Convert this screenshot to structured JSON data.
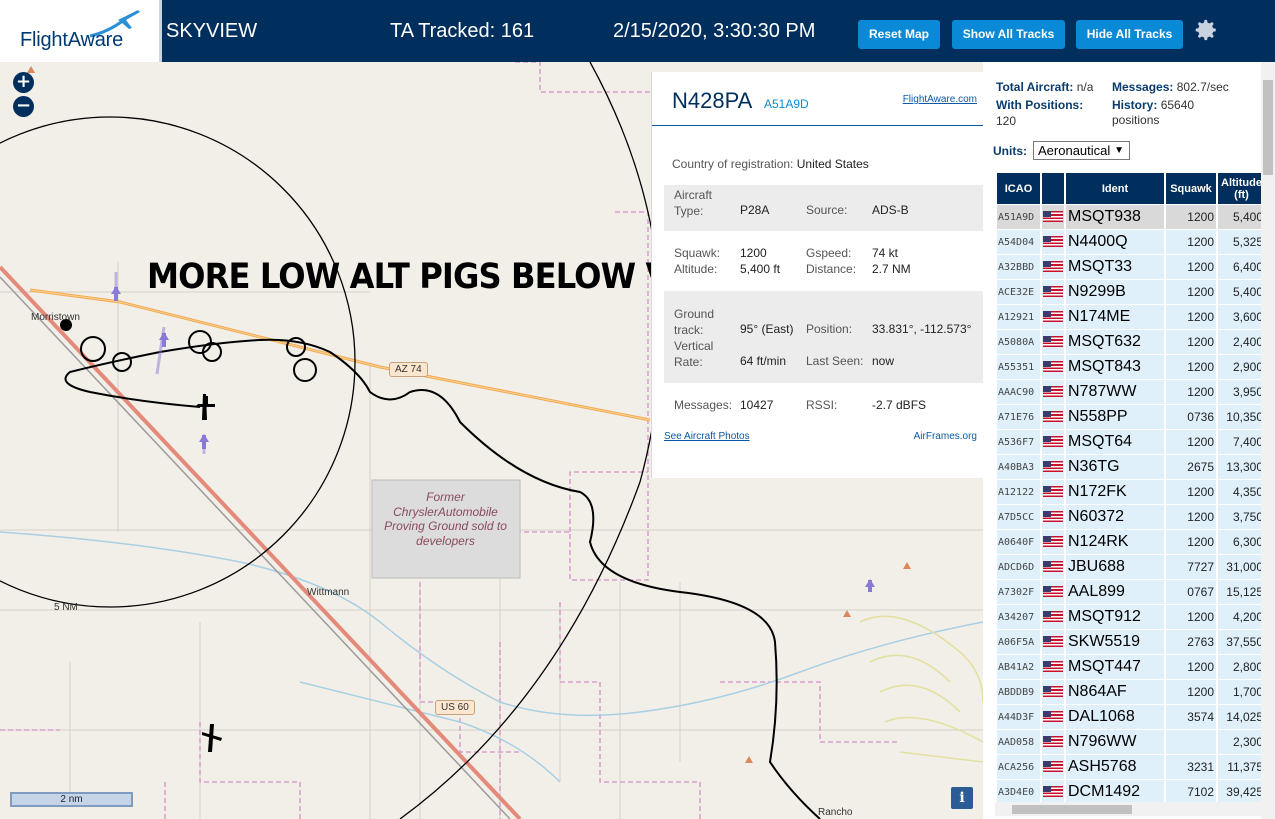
{
  "header": {
    "logo_text": "FlightAware",
    "app_name": "SKYVIEW",
    "tracked": "TA Tracked: 161",
    "datetime": "2/15/2020, 3:30:30 PM",
    "buttons": {
      "reset_map": "Reset Map",
      "show_all_tracks": "Show All Tracks",
      "hide_all_tracks": "Hide All Tracks"
    },
    "settings_icon": "gear-icon"
  },
  "map": {
    "zoom_in": "+",
    "zoom_out": "−",
    "overlay_caption": "MORE LOW ALT PIGS BELOW VFR",
    "labels": {
      "town1": "Morristown",
      "town2": "Wittmann",
      "range_ring": "5 NM",
      "hwy1": "AZ 74",
      "hwy2": "US 60",
      "proving_ground": "Former ChryslerAutomobile Proving Ground sold to developers",
      "bottom_place": "Rancho",
      "scale": "2 nm"
    },
    "info_button": "i",
    "colors": {
      "land": "#f2efe9",
      "highway": "#f2a94e",
      "railway_road": "#e48a7a",
      "boundary": "#d38fc8",
      "water": "#a9cfe3"
    }
  },
  "selected_aircraft": {
    "callsign": "N428PA",
    "icao": "A51A9D",
    "fa_link": "FlightAware.com",
    "country_label": "Country of registration:",
    "country": "United States",
    "aircraft_type_label": "Aircraft Type:",
    "aircraft_type": "P28A",
    "source_label": "Source:",
    "source": "ADS-B",
    "squawk_label": "Squawk:",
    "squawk": "1200",
    "gspeed_label": "Gspeed:",
    "gspeed": "74 kt",
    "altitude_label": "Altitude:",
    "altitude": "5,400 ft",
    "distance_label": "Distance:",
    "distance": "2.7 NM",
    "ground_track_label": "Ground track:",
    "ground_track": "95° (East)",
    "position_label": "Position:",
    "position": "33.831°, -112.573°",
    "vertical_rate_label": "Vertical Rate:",
    "vertical_rate": "64 ft/min",
    "last_seen_label": "Last Seen:",
    "last_seen": "now",
    "messages_label": "Messages:",
    "messages": "10427",
    "rssi_label": "RSSI:",
    "rssi": "-2.7 dBFS",
    "photos_link": "See Aircraft Photos",
    "airframes_link": "AirFrames.org"
  },
  "sidebar": {
    "total_aircraft_label": "Total Aircraft:",
    "total_aircraft": "n/a",
    "messages_label": "Messages:",
    "messages": "802.7/sec",
    "with_positions_label": "With Positions:",
    "with_positions": "120",
    "history_label": "History:",
    "history": "65640 positions",
    "units_label": "Units:",
    "units_value": "Aeronautical",
    "table": {
      "headers": [
        "ICAO",
        "",
        "Ident",
        "Squawk",
        "Altitude (ft)"
      ],
      "rows": [
        {
          "icao": "A51A9D",
          "ident": "MSQT938",
          "squawk": "1200",
          "alt": "5,400"
        },
        {
          "icao": "A54D04",
          "ident": "N4400Q",
          "squawk": "1200",
          "alt": "5,325"
        },
        {
          "icao": "A32BBD",
          "ident": "MSQT33",
          "squawk": "1200",
          "alt": "6,400"
        },
        {
          "icao": "ACE32E",
          "ident": "N9299B",
          "squawk": "1200",
          "alt": "5,400"
        },
        {
          "icao": "A12921",
          "ident": "N174ME",
          "squawk": "1200",
          "alt": "3,600"
        },
        {
          "icao": "A5080A",
          "ident": "MSQT632",
          "squawk": "1200",
          "alt": "2,400"
        },
        {
          "icao": "A55351",
          "ident": "MSQT843",
          "squawk": "1200",
          "alt": "2,900"
        },
        {
          "icao": "AAAC90",
          "ident": "N787WW",
          "squawk": "1200",
          "alt": "3,950"
        },
        {
          "icao": "A71E76",
          "ident": "N558PP",
          "squawk": "0736",
          "alt": "10,350"
        },
        {
          "icao": "A536F7",
          "ident": "MSQT64",
          "squawk": "1200",
          "alt": "7,400"
        },
        {
          "icao": "A40BA3",
          "ident": "N36TG",
          "squawk": "2675",
          "alt": "13,300"
        },
        {
          "icao": "A12122",
          "ident": "N172FK",
          "squawk": "1200",
          "alt": "4,350"
        },
        {
          "icao": "A7D5CC",
          "ident": "N60372",
          "squawk": "1200",
          "alt": "3,750"
        },
        {
          "icao": "A0640F",
          "ident": "N124RK",
          "squawk": "1200",
          "alt": "6,300"
        },
        {
          "icao": "ADCD6D",
          "ident": "JBU688",
          "squawk": "7727",
          "alt": "31,000"
        },
        {
          "icao": "A7302F",
          "ident": "AAL899",
          "squawk": "0767",
          "alt": "15,125"
        },
        {
          "icao": "A34207",
          "ident": "MSQT912",
          "squawk": "1200",
          "alt": "4,200"
        },
        {
          "icao": "A06F5A",
          "ident": "SKW5519",
          "squawk": "2763",
          "alt": "37,550"
        },
        {
          "icao": "AB41A2",
          "ident": "MSQT447",
          "squawk": "1200",
          "alt": "2,800"
        },
        {
          "icao": "ABDDB9",
          "ident": "N864AF",
          "squawk": "1200",
          "alt": "1,700"
        },
        {
          "icao": "A44D3F",
          "ident": "DAL1068",
          "squawk": "3574",
          "alt": "14,025"
        },
        {
          "icao": "AAD058",
          "ident": "N796WW",
          "squawk": "",
          "alt": "2,300"
        },
        {
          "icao": "ACA256",
          "ident": "ASH5768",
          "squawk": "3231",
          "alt": "11,375"
        },
        {
          "icao": "A3D4E0",
          "ident": "DCM1492",
          "squawk": "7102",
          "alt": "39,425"
        }
      ]
    }
  }
}
